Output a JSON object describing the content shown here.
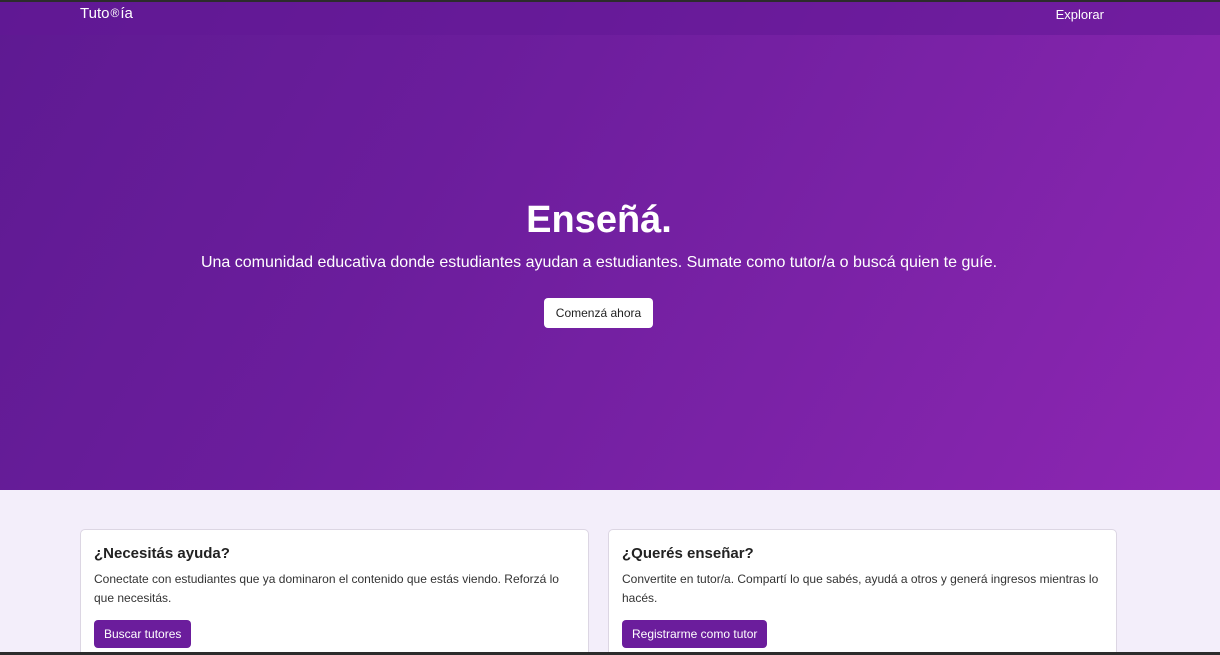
{
  "nav": {
    "brand_prefix": "Tuto",
    "brand_icon": "®",
    "brand_suffix": "ía",
    "brand_icon_name": "registered-icon",
    "explore_label": "Explorar"
  },
  "hero": {
    "title": "Enseñá.",
    "subtitle": "Una comunidad educativa donde estudiantes ayudan a estudiantes. Sumate como tutor/a o buscá quien te guíe.",
    "cta_label": "Comenzá ahora"
  },
  "cards": {
    "help": {
      "title": "¿Necesitás ayuda?",
      "text": "Conectate con estudiantes que ya dominaron el contenido que estás viendo. Reforzá lo que necesitás.",
      "button_label": "Buscar tutores"
    },
    "teach": {
      "title": "¿Querés enseñar?",
      "text": "Convertite en tutor/a. Compartí lo que sabés, ayudá a otros y generá ingresos mientras lo hacés.",
      "button_label": "Registrarme como tutor"
    }
  },
  "colors": {
    "hero_start": "#5e1a92",
    "hero_end": "#8d26b2",
    "accent": "#6b1d9c",
    "page_bg": "#f3eefa"
  }
}
